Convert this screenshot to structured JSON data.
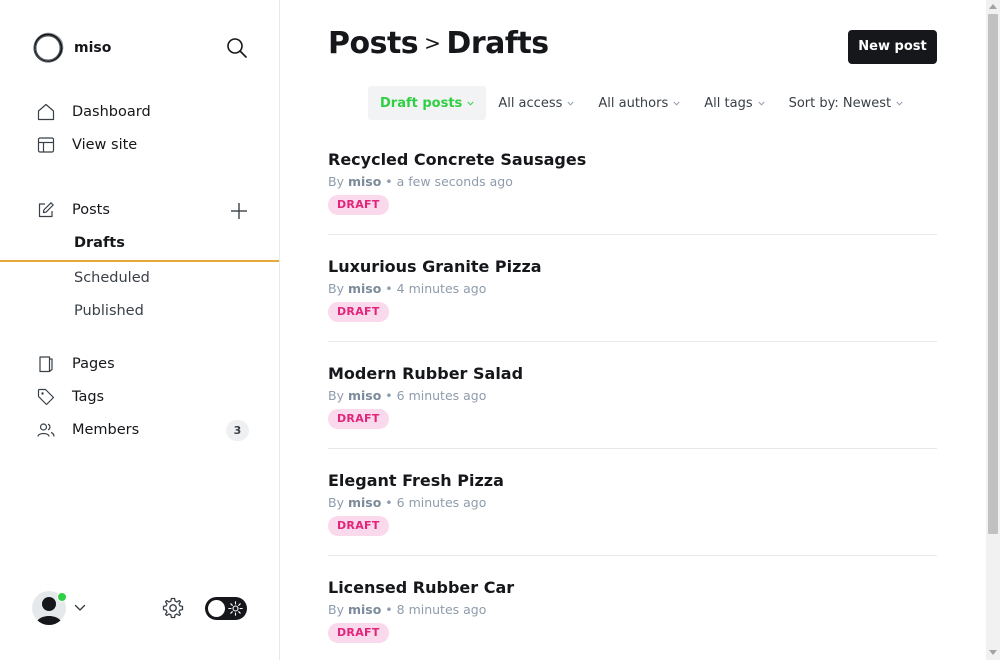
{
  "brand": {
    "name": "miso"
  },
  "sidebar": {
    "nav": [
      {
        "label": "Dashboard",
        "icon": "home-icon"
      },
      {
        "label": "View site",
        "icon": "layout-icon"
      }
    ],
    "posts": {
      "label": "Posts",
      "icon": "edit-icon",
      "subitems": [
        {
          "label": "Drafts",
          "active": true
        },
        {
          "label": "Scheduled",
          "active": false
        },
        {
          "label": "Published",
          "active": false
        }
      ]
    },
    "secondary": [
      {
        "label": "Pages",
        "icon": "page-icon"
      },
      {
        "label": "Tags",
        "icon": "tag-icon"
      },
      {
        "label": "Members",
        "icon": "members-icon",
        "count": "3"
      }
    ]
  },
  "header": {
    "breadcrumb_parent": "Posts",
    "breadcrumb_separator": ">",
    "breadcrumb_current": "Drafts",
    "new_post_label": "New post"
  },
  "filters": [
    {
      "label": "Draft posts",
      "active": true
    },
    {
      "label": "All access",
      "active": false
    },
    {
      "label": "All authors",
      "active": false
    },
    {
      "label": "All tags",
      "active": false
    },
    {
      "label": "Sort by: Newest",
      "active": false
    }
  ],
  "posts": [
    {
      "title": "Recycled Concrete Sausages",
      "by": "By",
      "author": "miso",
      "time": "a few seconds ago",
      "status": "DRAFT"
    },
    {
      "title": "Luxurious Granite Pizza",
      "by": "By",
      "author": "miso",
      "time": "4 minutes ago",
      "status": "DRAFT"
    },
    {
      "title": "Modern Rubber Salad",
      "by": "By",
      "author": "miso",
      "time": "6 minutes ago",
      "status": "DRAFT"
    },
    {
      "title": "Elegant Fresh Pizza",
      "by": "By",
      "author": "miso",
      "time": "6 minutes ago",
      "status": "DRAFT"
    },
    {
      "title": "Licensed Rubber Car",
      "by": "By",
      "author": "miso",
      "time": "8 minutes ago",
      "status": "DRAFT"
    }
  ],
  "colors": {
    "accent_green": "#30cf43",
    "draft_badge_bg": "#fbd9ec",
    "draft_badge_text": "#e1257a",
    "active_underline": "#e8a73a",
    "primary_button": "#15171a"
  }
}
